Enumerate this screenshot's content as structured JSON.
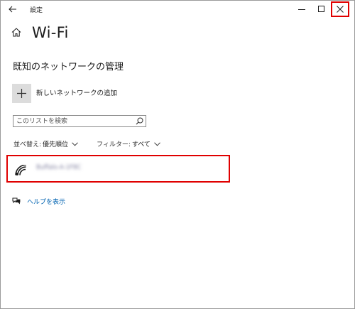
{
  "window": {
    "title": "設定",
    "back_icon": "arrow-left-icon",
    "minimize_icon": "minimize-icon",
    "maximize_icon": "maximize-icon",
    "close_icon": "close-icon",
    "highlight_color": "#e00000"
  },
  "header": {
    "home_icon": "home-icon",
    "title": "Wi-Fi"
  },
  "section": {
    "heading": "既知のネットワークの管理"
  },
  "add_network": {
    "icon": "plus-icon",
    "label": "新しいネットワークの追加"
  },
  "search": {
    "placeholder": "このリストを検索",
    "value": "",
    "icon": "search-icon"
  },
  "sort": {
    "label": "並べ替え:",
    "value": "優先順位"
  },
  "filter": {
    "label": "フィルター:",
    "value": "すべて"
  },
  "networks": [
    {
      "name": "Buffalo-A-1F8C",
      "icon": "wifi-icon"
    }
  ],
  "help": {
    "icon": "help-chat-icon",
    "label": "ヘルプを表示",
    "link_color": "#0063b1"
  }
}
